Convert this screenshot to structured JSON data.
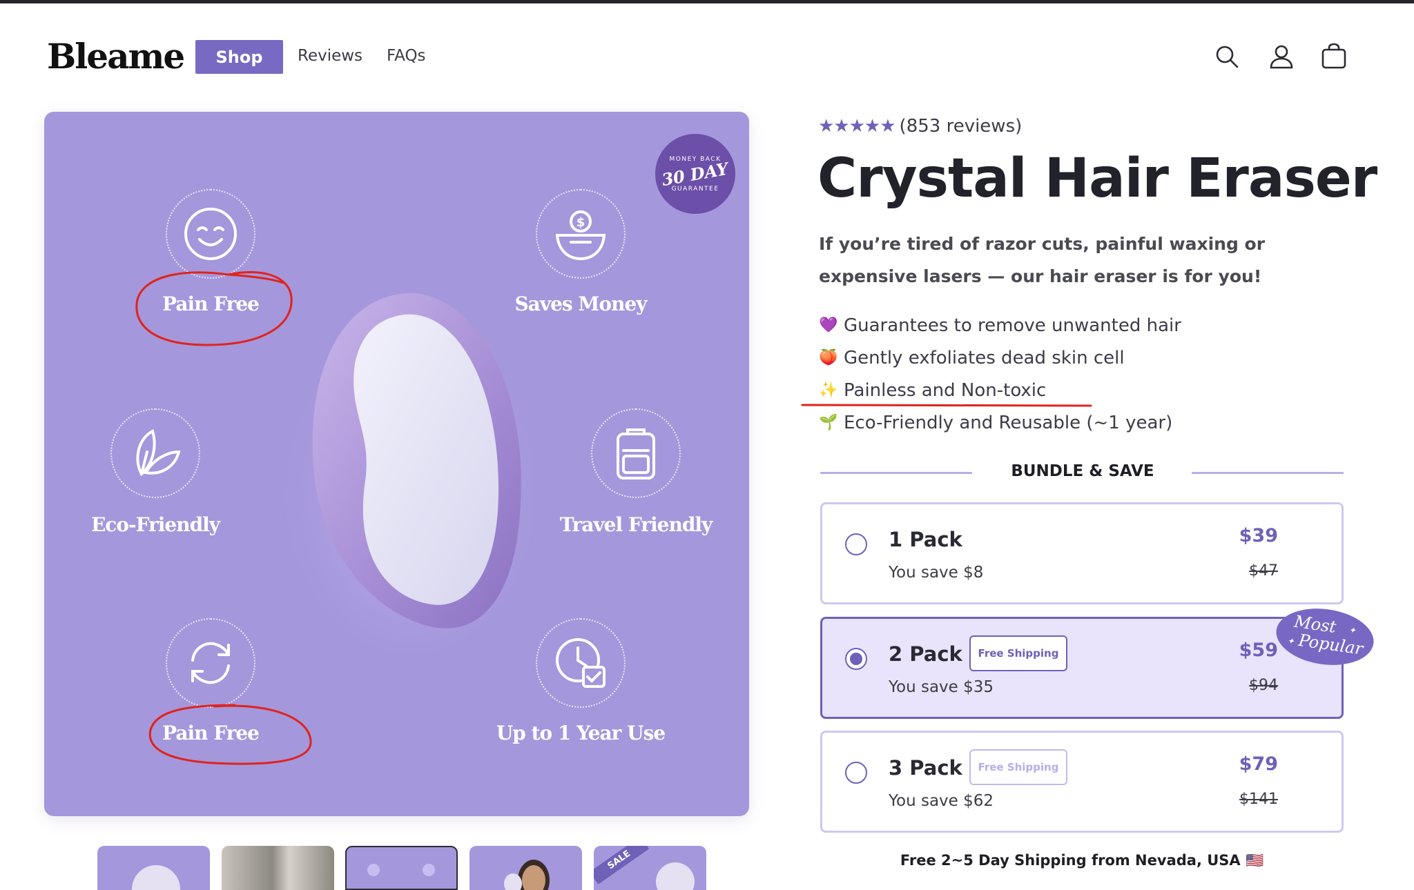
{
  "brand": {
    "logo": "Bleame"
  },
  "nav": {
    "shop": "Shop",
    "reviews": "Reviews",
    "faqs": "FAQs"
  },
  "header_icons": [
    "search-icon",
    "account-icon",
    "cart-icon"
  ],
  "hero": {
    "badge": {
      "top": "MONEY BACK",
      "main": "30 DAY",
      "bottom": "GUARANTEE"
    },
    "features": [
      {
        "label": "Pain Free",
        "icon": "smile-icon"
      },
      {
        "label": "Saves Money",
        "icon": "money-bowl-icon"
      },
      {
        "label": "Eco-Friendly",
        "icon": "leaf-icon"
      },
      {
        "label": "Travel Friendly",
        "icon": "backpack-icon"
      },
      {
        "label": "Pain Free",
        "icon": "refresh-icon"
      },
      {
        "label": "Up to 1 Year Use",
        "icon": "clock-check-icon"
      }
    ],
    "thumb_sale_label": "SALE"
  },
  "product": {
    "stars": "★★★★★",
    "reviews": "(853 reviews)",
    "title": "Crystal Hair Eraser",
    "subtitle": "If you’re tired of razor cuts, painful waxing or expensive lasers — our hair eraser is for you!",
    "bullets": [
      {
        "emoji": "💜",
        "text": "Guarantees to remove unwanted hair"
      },
      {
        "emoji": "🍑",
        "text": "Gently exfoliates dead skin cell"
      },
      {
        "emoji": "✨",
        "text": "Painless and Non-toxic"
      },
      {
        "emoji": "🌱",
        "text": "Eco-Friendly and Reusable (~1 year)"
      }
    ]
  },
  "bundle": {
    "title": "BUNDLE & SAVE",
    "packs": [
      {
        "name": "1 Pack",
        "save": "You save $8",
        "price": "$39",
        "old_price": "$47",
        "badge": "",
        "selected": false
      },
      {
        "name": "2 Pack",
        "save": "You save $35",
        "price": "$59",
        "old_price": "$94",
        "badge": "Free Shipping",
        "selected": true
      },
      {
        "name": "3 Pack",
        "save": "You save $62",
        "price": "$79",
        "old_price": "$141",
        "badge": "Free Shipping",
        "selected": false
      }
    ],
    "popular": {
      "line1": "Most",
      "line2": "Popular"
    }
  },
  "shipping_note": "Free 2~5 Day Shipping from Nevada, USA 🇺🇸",
  "colors": {
    "accent": "#6f60b8",
    "hero_bg": "#a597dc",
    "annotation": "#e0231c"
  }
}
